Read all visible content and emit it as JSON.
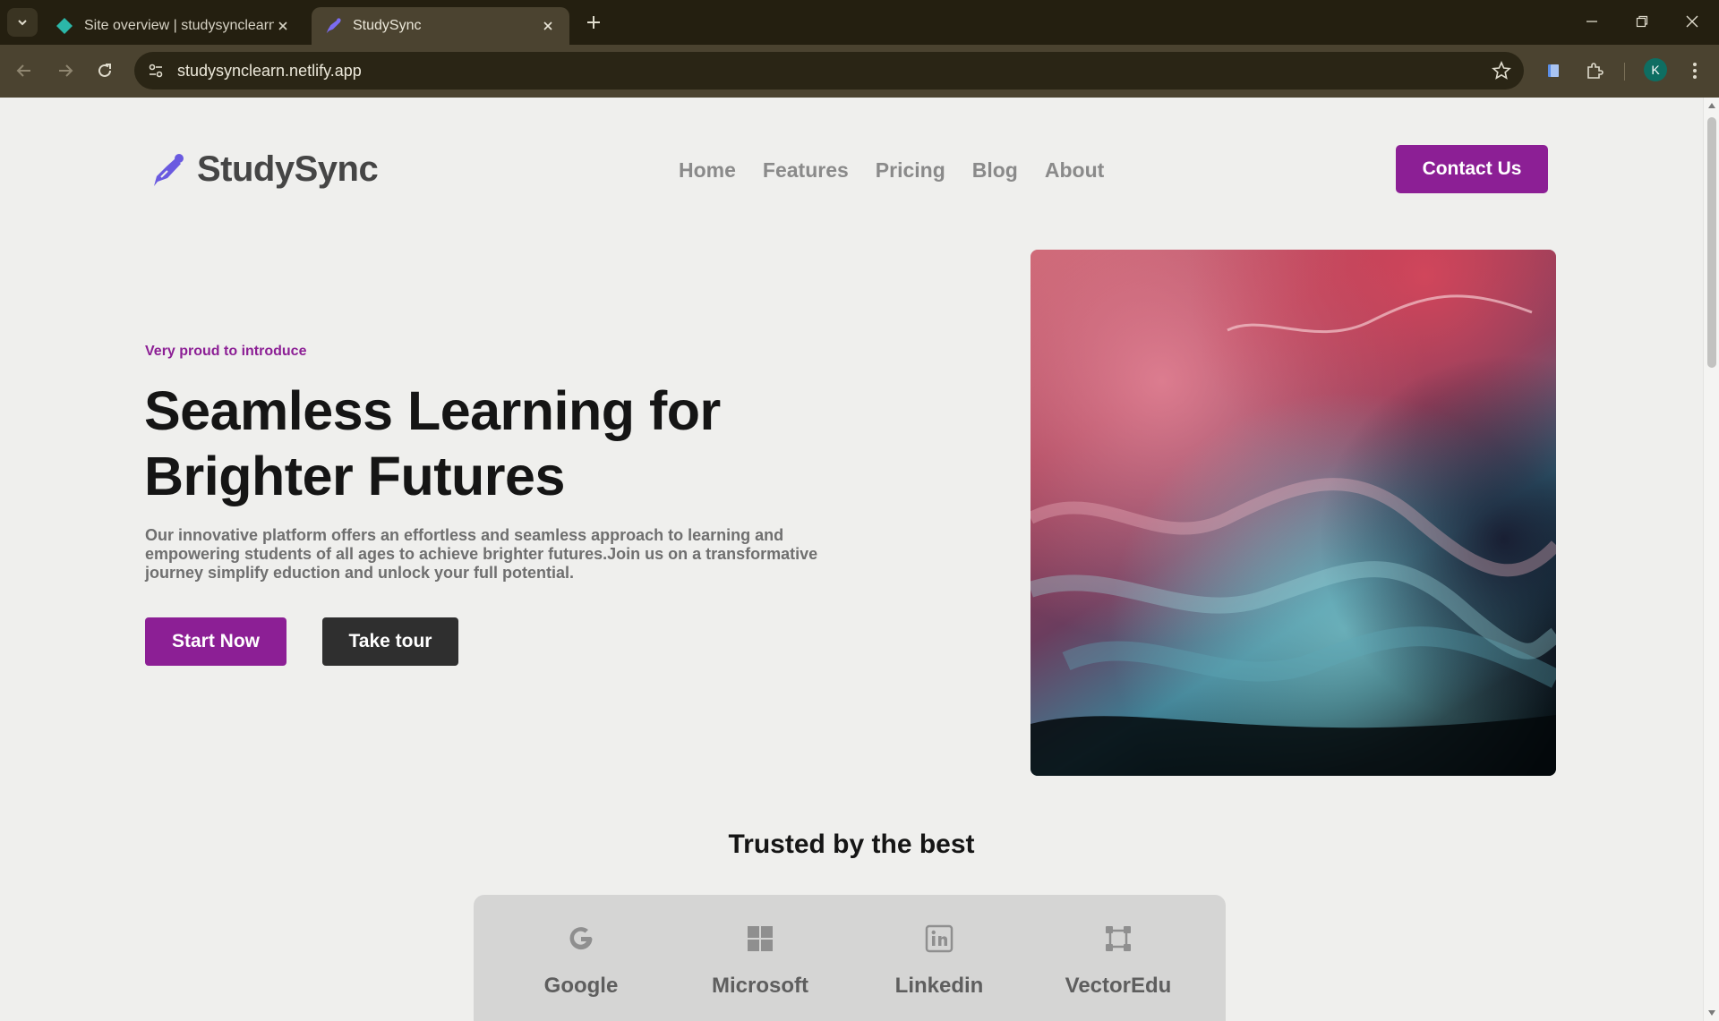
{
  "browser": {
    "tabs": [
      {
        "title": "Site overview | studysynclearn |",
        "active": false,
        "favicon": "netlify-diamond-icon"
      },
      {
        "title": "StudySync",
        "active": true,
        "favicon": "pen-nib-icon"
      }
    ],
    "url": "studysynclearn.netlify.app",
    "profile_initial": "K"
  },
  "site": {
    "brand": "StudySync",
    "nav": [
      "Home",
      "Features",
      "Pricing",
      "Blog",
      "About"
    ],
    "contact_label": "Contact Us"
  },
  "hero": {
    "eyebrow": "Very proud to introduce",
    "headline_line1": "Seamless Learning for",
    "headline_line2": "Brighter Futures",
    "description": "Our innovative platform offers an effortless and seamless approach to learning and empowering students of all ages to achieve brighter futures.Join us on a transformative journey simplify eduction and unlock your full potential.",
    "primary_cta": "Start Now",
    "secondary_cta": "Take tour"
  },
  "trusted": {
    "title": "Trusted by the best",
    "partners": [
      {
        "name": "Google",
        "icon": "google-icon"
      },
      {
        "name": "Microsoft",
        "icon": "microsoft-icon"
      },
      {
        "name": "Linkedin",
        "icon": "linkedin-icon"
      },
      {
        "name": "VectorEdu",
        "icon": "vector-square-icon"
      }
    ]
  },
  "colors": {
    "accent": "#8c1f95",
    "dark_button": "#2f2f2f",
    "page_background": "#efefed",
    "chrome_dark": "#241f10",
    "chrome_toolbar": "#4b4330"
  }
}
